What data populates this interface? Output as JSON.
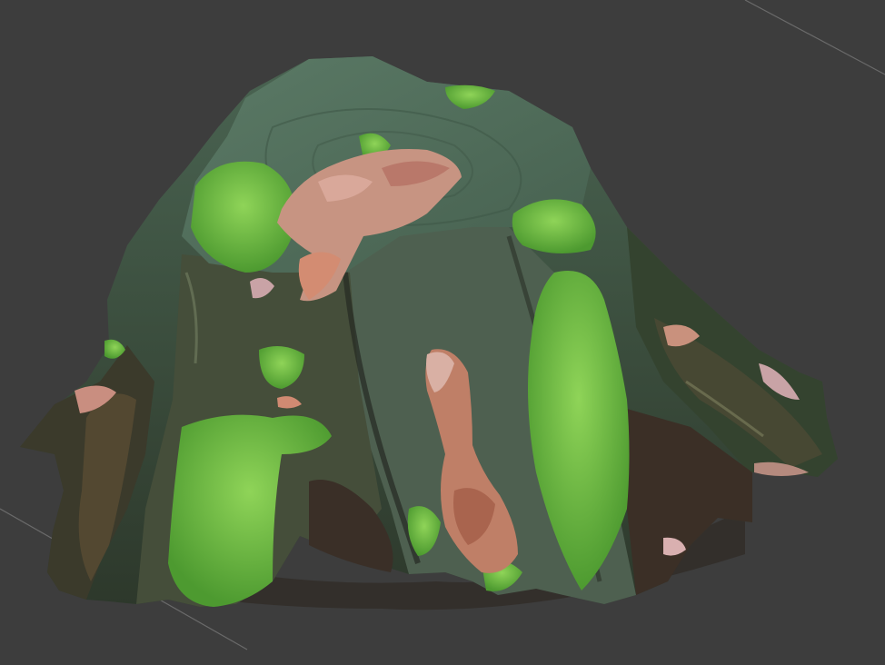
{
  "viewport": {
    "background_color": "#3d3d3d",
    "grid_line_color": "#6a6a6a"
  },
  "model": {
    "subject": "tree-stump",
    "colors": {
      "wood_top": "#4f6b58",
      "wood_side": "#3e5545",
      "bark_dark": "#2a3327",
      "bark_brown": "#5a4a34",
      "moss": "#5fae3a",
      "moss_light": "#86cf52",
      "leaf": "#c9917d",
      "leaf_dark": "#9c6452",
      "soil": "#4a3a2e"
    }
  }
}
